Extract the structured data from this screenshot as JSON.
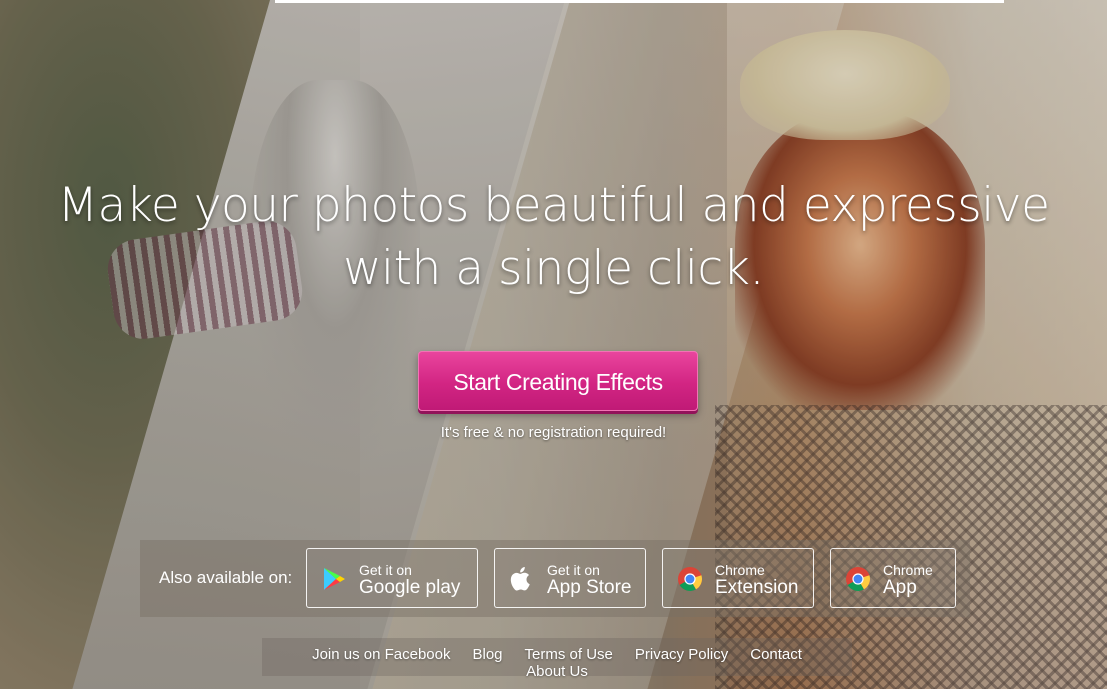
{
  "hero": {
    "headline_line1": "Make your photos beautiful and expressive",
    "headline_line2": "with a single click.",
    "cta_label": "Start Creating Effects",
    "note": "It's free & no registration required!"
  },
  "availability": {
    "label": "Also available on:",
    "stores": [
      {
        "icon": "google-play-icon",
        "line1": "Get it on",
        "line2": "Google play"
      },
      {
        "icon": "apple-icon",
        "line1": "Get it on",
        "line2": "App Store"
      },
      {
        "icon": "chrome-icon",
        "line1": "Chrome",
        "line2": "Extension"
      },
      {
        "icon": "chrome-icon",
        "line1": "Chrome",
        "line2": "App"
      }
    ]
  },
  "footer": {
    "links": [
      "Join us on Facebook",
      "Blog",
      "Terms of Use",
      "Privacy Policy",
      "Contact",
      "About Us"
    ]
  },
  "colors": {
    "cta": "#d22583",
    "text": "#ffffff"
  }
}
